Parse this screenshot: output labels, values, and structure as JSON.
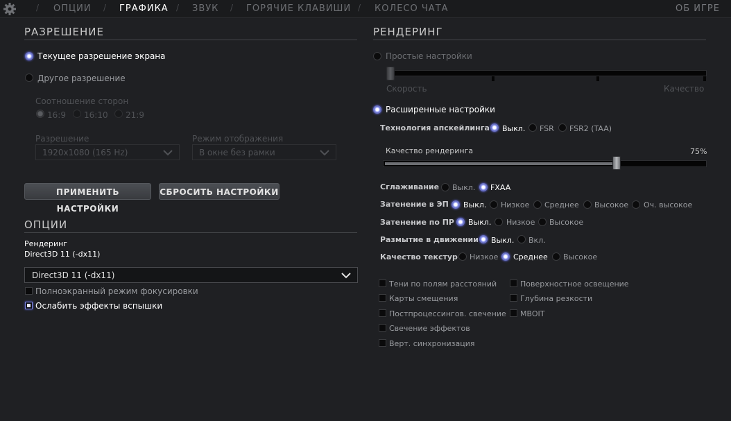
{
  "nav": {
    "tabs": [
      "ОПЦИИ",
      "ГРАФИКА",
      "ЗВУК",
      "ГОРЯЧИЕ КЛАВИШИ",
      "КОЛЕСО ЧАТА"
    ],
    "active": "ГРАФИКА",
    "about": "ОБ ИГРЕ"
  },
  "resolution": {
    "title": "РАЗРЕШЕНИЕ",
    "current_label": "Текущее разрешение экрана",
    "other_label": "Другое разрешение",
    "aspect_label": "Соотношение сторон",
    "aspects": [
      "16:9",
      "16:10",
      "21:9"
    ],
    "res_label": "Разрешение",
    "res_value": "1920x1080 (165 Hz)",
    "mode_label": "Режим отображения",
    "mode_value": "В окне без рамки",
    "apply": "ПРИМЕНИТЬ НАСТРОЙКИ",
    "reset": "СБРОСИТЬ НАСТРОЙКИ"
  },
  "options": {
    "title": "ОПЦИИ",
    "rendering_label": "Рендеринг",
    "rendering_current": "Direct3D 11 (-dx11)",
    "rendering_select": "Direct3D 11 (-dx11)",
    "fullscreen_focus": "Полноэкранный режим фокусировки",
    "weaken_flash": "Ослабить эффекты вспышки"
  },
  "render": {
    "title": "РЕНДЕРИНГ",
    "simple_label": "Простые настройки",
    "speed": "Скорость",
    "quality": "Качество",
    "advanced_label": "Расширенные настройки",
    "upscale_label": "Технология апскейлинга",
    "upscale_opts": [
      "Выкл.",
      "FSR",
      "FSR2 (TAA)"
    ],
    "render_quality_label": "Качество рендеринга",
    "render_quality_value": "75%",
    "render_quality_fraction": 0.75,
    "aa_label": "Сглаживание",
    "aa_opts": [
      "Выкл.",
      "FXAA"
    ],
    "shadow_ep_label": "Затенение в ЭП",
    "shadow_ep_opts": [
      "Выкл.",
      "Низкое",
      "Среднее",
      "Высокое",
      "Оч. высокое"
    ],
    "shadow_pr_label": "Затенение по ПР",
    "shadow_pr_opts": [
      "Выкл.",
      "Низкое",
      "Высокое"
    ],
    "motion_blur_label": "Размытие в движении",
    "motion_blur_opts": [
      "Выкл.",
      "Вкл."
    ],
    "texture_label": "Качество текстур",
    "texture_opts": [
      "Низкое",
      "Среднее",
      "Высокое"
    ],
    "checks_left": [
      "Тени по полям расстояний",
      "Карты смещения",
      "Постпроцессингов. свечение",
      "Свечение эффектов",
      "Верт. синхронизация"
    ],
    "checks_right": [
      "Поверхностное освещение",
      "Глубина резкости",
      "MBOIT"
    ]
  }
}
